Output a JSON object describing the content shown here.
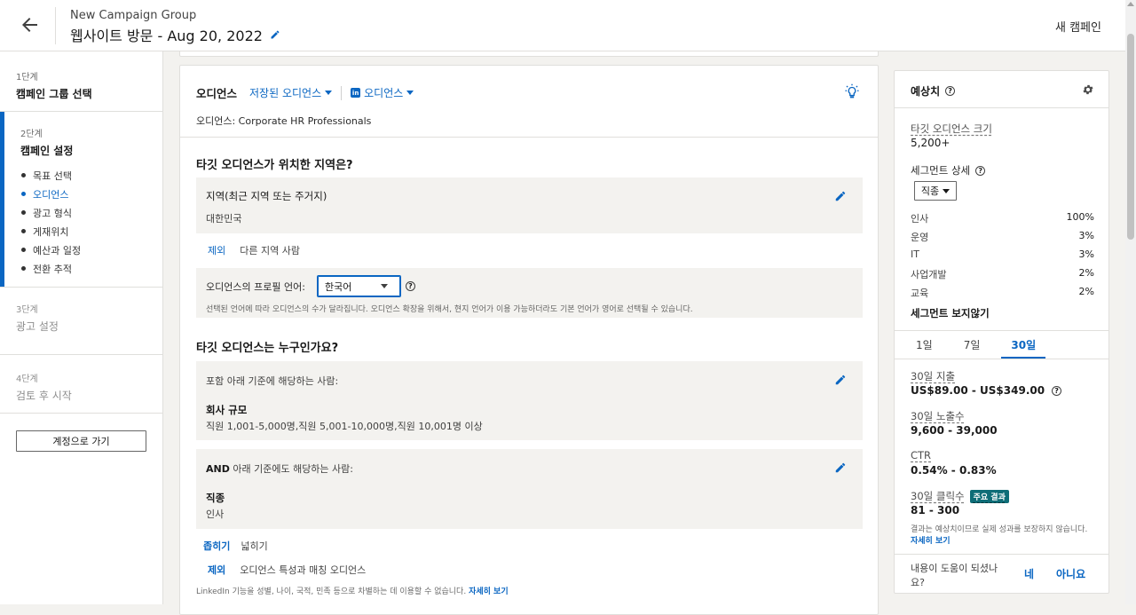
{
  "header": {
    "group_name": "New Campaign Group",
    "campaign_title": "웹사이트 방문 - Aug 20, 2022",
    "new_campaign": "새 캠페인"
  },
  "sidebar": {
    "step1": {
      "label": "1단계",
      "title": "캠페인 그룹 선택"
    },
    "step2": {
      "label": "2단계",
      "title": "캠페인 설정",
      "items": [
        "목표 선택",
        "오디언스",
        "광고 형식",
        "게재위치",
        "예산과 일정",
        "전환 추적"
      ],
      "active": "오디언스"
    },
    "step3": {
      "label": "3단계",
      "title": "광고 설정"
    },
    "step4": {
      "label": "4단계",
      "title": "검토 후 시작"
    },
    "goto_account": "계정으로 가기"
  },
  "audience": {
    "heading": "오디언스",
    "saved_audiences": "저장된 오디언스",
    "li_audiences": "오디언스",
    "name_line": "오디언스: Corporate HR Professionals",
    "location_q": "타깃 오디언스가 위치한 지역은?",
    "location_box_title": "지역(최근 지역 또는 주거지)",
    "location_value": "대한민국",
    "exclude": "제외",
    "exclude_people": "다른 지역 사람",
    "lang_label": "오디언스의 프로필 언어:",
    "lang_value": "한국어",
    "lang_note": "선택된 언어에 따라 오디언스의 수가 달라집니다. 오디언스 확장을 위해서, 현지 언어가 이용 가능하더라도 기본 언어가 영어로 선택될 수 있습니다.",
    "who_q": "타깃 오디언스는 누구인가요?",
    "include_label": "포함 아래 기준에 해당하는 사람:",
    "company_size_title": "회사 규모",
    "company_size_value": "직원 1,001-5,000명,직원 5,001-10,000명,직원 10,001명 이상",
    "and_bold": "AND",
    "and_label": "아래 기준에도 해당하는 사람:",
    "job_func_title": "직종",
    "job_func_value": "인사",
    "narrow": "좁히기",
    "broaden": "넓히기",
    "exclude2": "제외",
    "exclude2_text": "오디언스 특성과 매칭 오디언스",
    "footnote": "LinkedIn 기능을 성별, 나이, 국적, 민족 등으로 차별하는 데 이용할 수 없습니다.",
    "footnote_link": "자세히 보기"
  },
  "forecast": {
    "title": "예상치",
    "audience_size_label": "타깃 오디언스 크기",
    "audience_size_value": "5,200+",
    "segment_label": "세그먼트 상세",
    "segment_select": "직종",
    "segments": [
      {
        "name": "인사",
        "pct": "100%"
      },
      {
        "name": "운영",
        "pct": "3%"
      },
      {
        "name": "IT",
        "pct": "3%"
      },
      {
        "name": "사업개발",
        "pct": "2%"
      },
      {
        "name": "교육",
        "pct": "2%"
      }
    ],
    "hide_segments": "세그먼트 보지않기",
    "tabs": [
      "1일",
      "7일",
      "30일"
    ],
    "active_tab": "30일",
    "spend_label": "30일 지출",
    "spend_value": "US$89.00 - US$349.00",
    "impr_label": "30일 노출수",
    "impr_value": "9,600 - 39,000",
    "ctr_label": "CTR",
    "ctr_value": "0.54% - 0.83%",
    "clicks_label": "30일 클릭수",
    "key_result": "주요 결과",
    "clicks_value": "81 - 300",
    "note": "결과는 예상치이므로 실제 성과를 보장하지 않습니다.",
    "note_link": "자세히 보기",
    "helpful_q": "내용이 도움이 되셨나요?",
    "yes": "네",
    "no": "아니요"
  },
  "colors": {
    "accent": "#0a66c2",
    "badge": "#0e6d77",
    "background": "#f3f2ef"
  }
}
